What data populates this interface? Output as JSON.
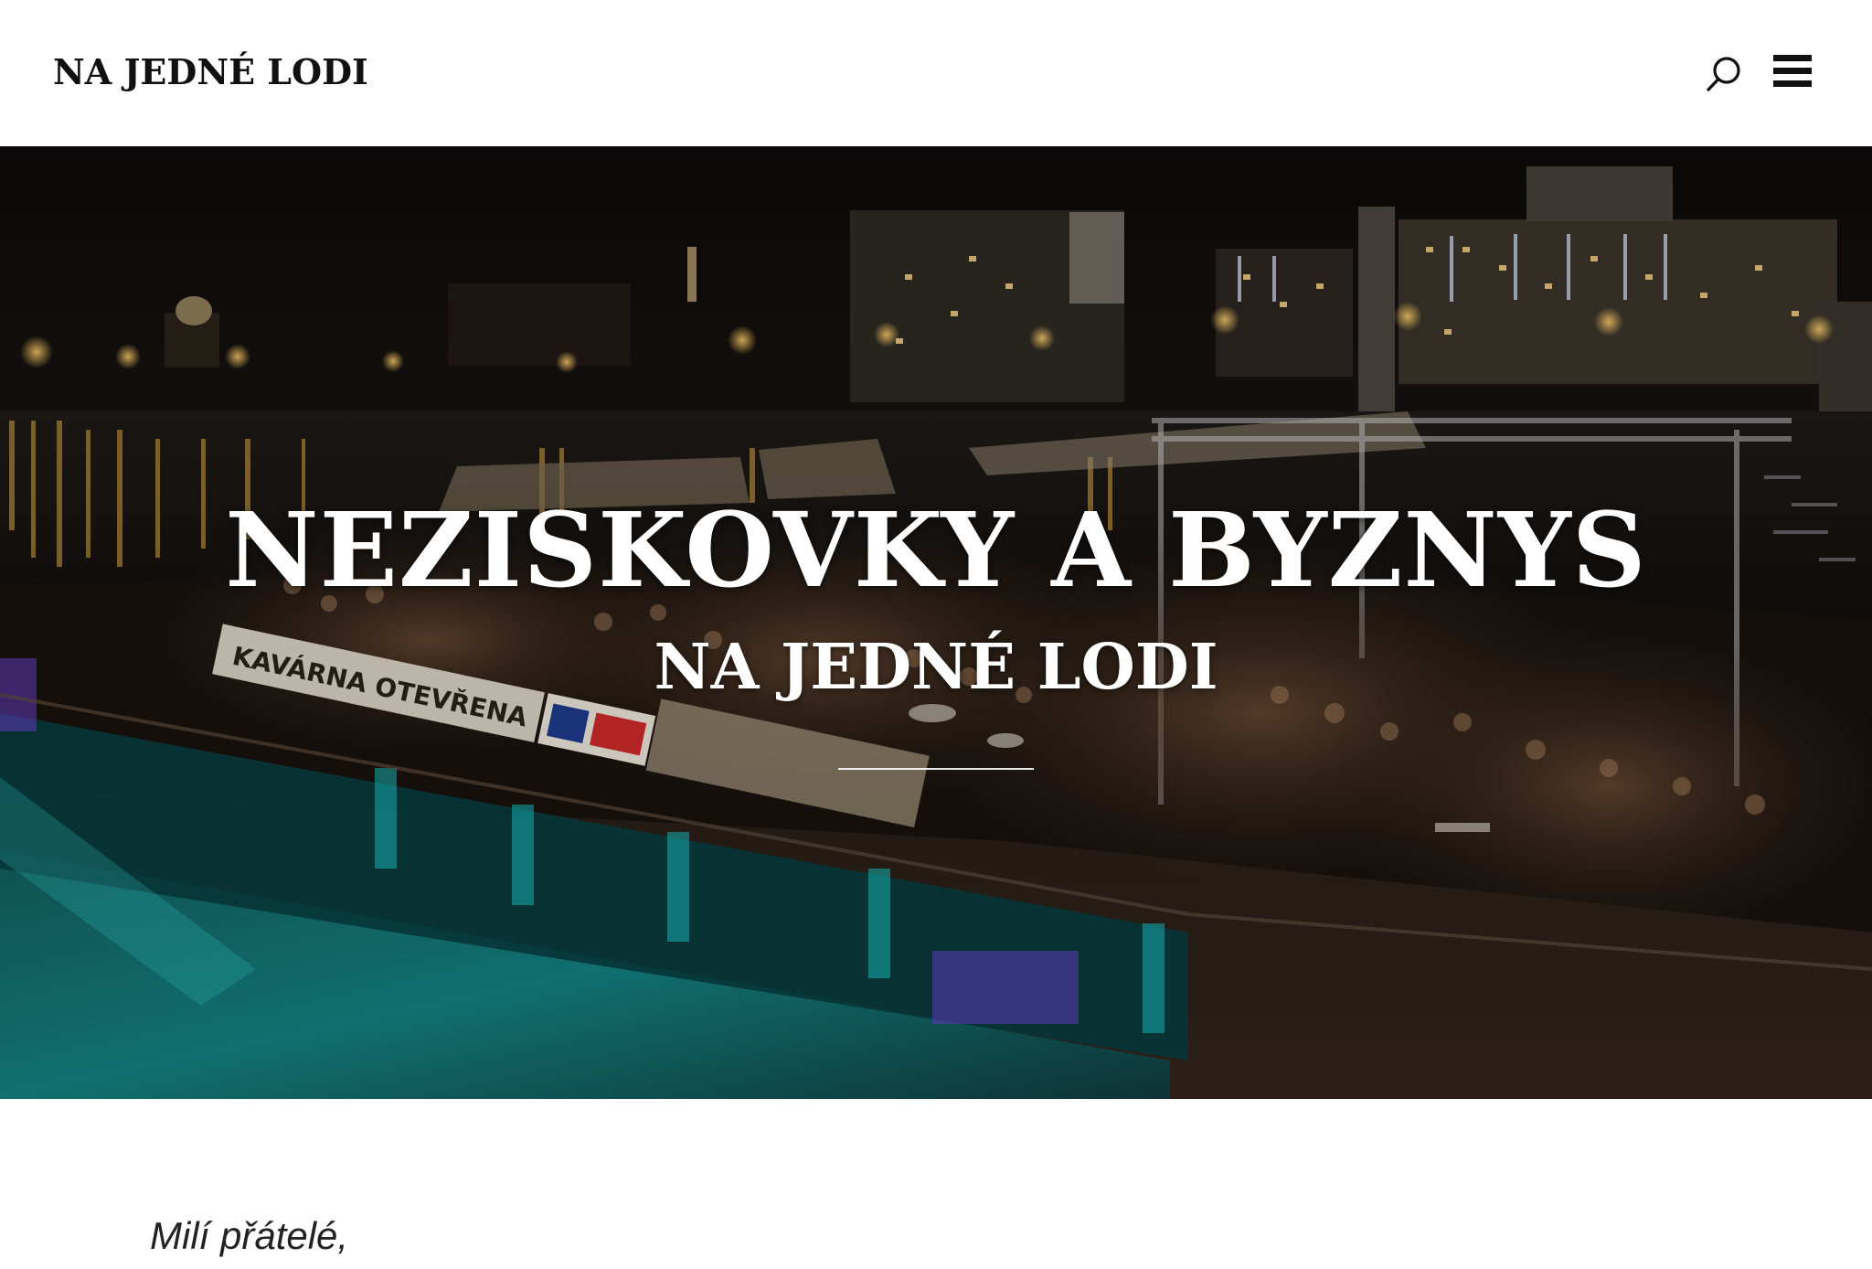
{
  "header": {
    "site_title": "NA JEDNÉ LODI",
    "search_icon": "search-icon",
    "menu_icon": "hamburger-menu-icon"
  },
  "hero": {
    "title": "NEZISKOVKY A BYZNYS",
    "subtitle": "NA JEDNÉ LODI",
    "image_description_icon": "night-boat-party-photo",
    "banner_text": "KAVÁRNA OTEVŘENA"
  },
  "content": {
    "greeting": "Milí přátelé,"
  },
  "colors": {
    "text_dark": "#111111",
    "hero_text": "#ffffff",
    "hero_dark": "#0b0a0b",
    "teal_light": "#19c4c4"
  }
}
